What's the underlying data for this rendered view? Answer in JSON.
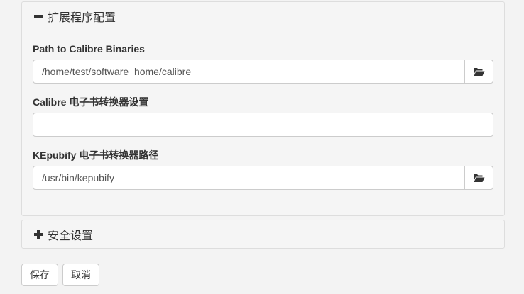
{
  "extensions_panel": {
    "title": "扩展程序配置",
    "expanded": true,
    "fields": {
      "calibre_binaries": {
        "label": "Path to Calibre Binaries",
        "value": "/home/test/software_home/calibre",
        "icon": "folder-open-icon"
      },
      "calibre_converter": {
        "label": "Calibre 电子书转换器设置",
        "value": ""
      },
      "kepubify_path": {
        "label": "KEpubify 电子书转换器路径",
        "value": "/usr/bin/kepubify",
        "icon": "folder-open-icon"
      }
    }
  },
  "security_panel": {
    "title": "安全设置",
    "expanded": false
  },
  "buttons": {
    "save_label": "保存",
    "cancel_label": "取消"
  }
}
